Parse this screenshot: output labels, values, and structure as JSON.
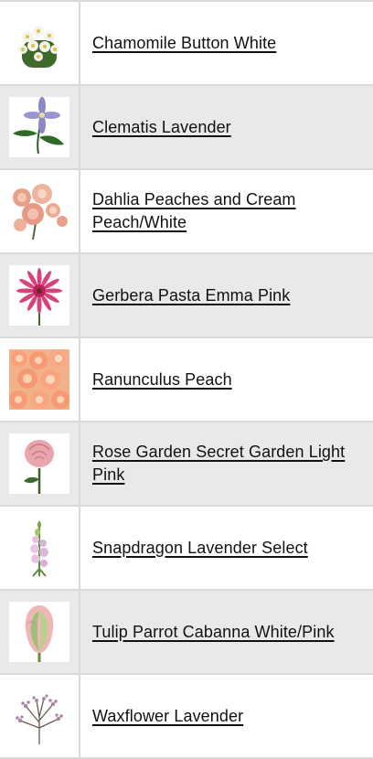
{
  "products": [
    {
      "name": "Chamomile Button White",
      "image_icon": "chamomile-flower-icon"
    },
    {
      "name": "Clematis Lavender",
      "image_icon": "clematis-flower-icon"
    },
    {
      "name": "Dahlia Peaches and Cream Peach/White",
      "image_icon": "dahlia-flower-icon"
    },
    {
      "name": "Gerbera Pasta Emma Pink",
      "image_icon": "gerbera-flower-icon"
    },
    {
      "name": "Ranunculus Peach",
      "image_icon": "ranunculus-flower-icon"
    },
    {
      "name": "Rose Garden Secret Garden Light Pink",
      "image_icon": "rose-flower-icon"
    },
    {
      "name": "Snapdragon Lavender Select",
      "image_icon": "snapdragon-flower-icon"
    },
    {
      "name": "Tulip Parrot Cabanna White/Pink",
      "image_icon": "tulip-flower-icon"
    },
    {
      "name": "Waxflower Lavender",
      "image_icon": "waxflower-icon"
    }
  ],
  "colors": {
    "row_shade": "#e9e9e9",
    "border": "#d9d9d9",
    "link_text": "#111111"
  }
}
